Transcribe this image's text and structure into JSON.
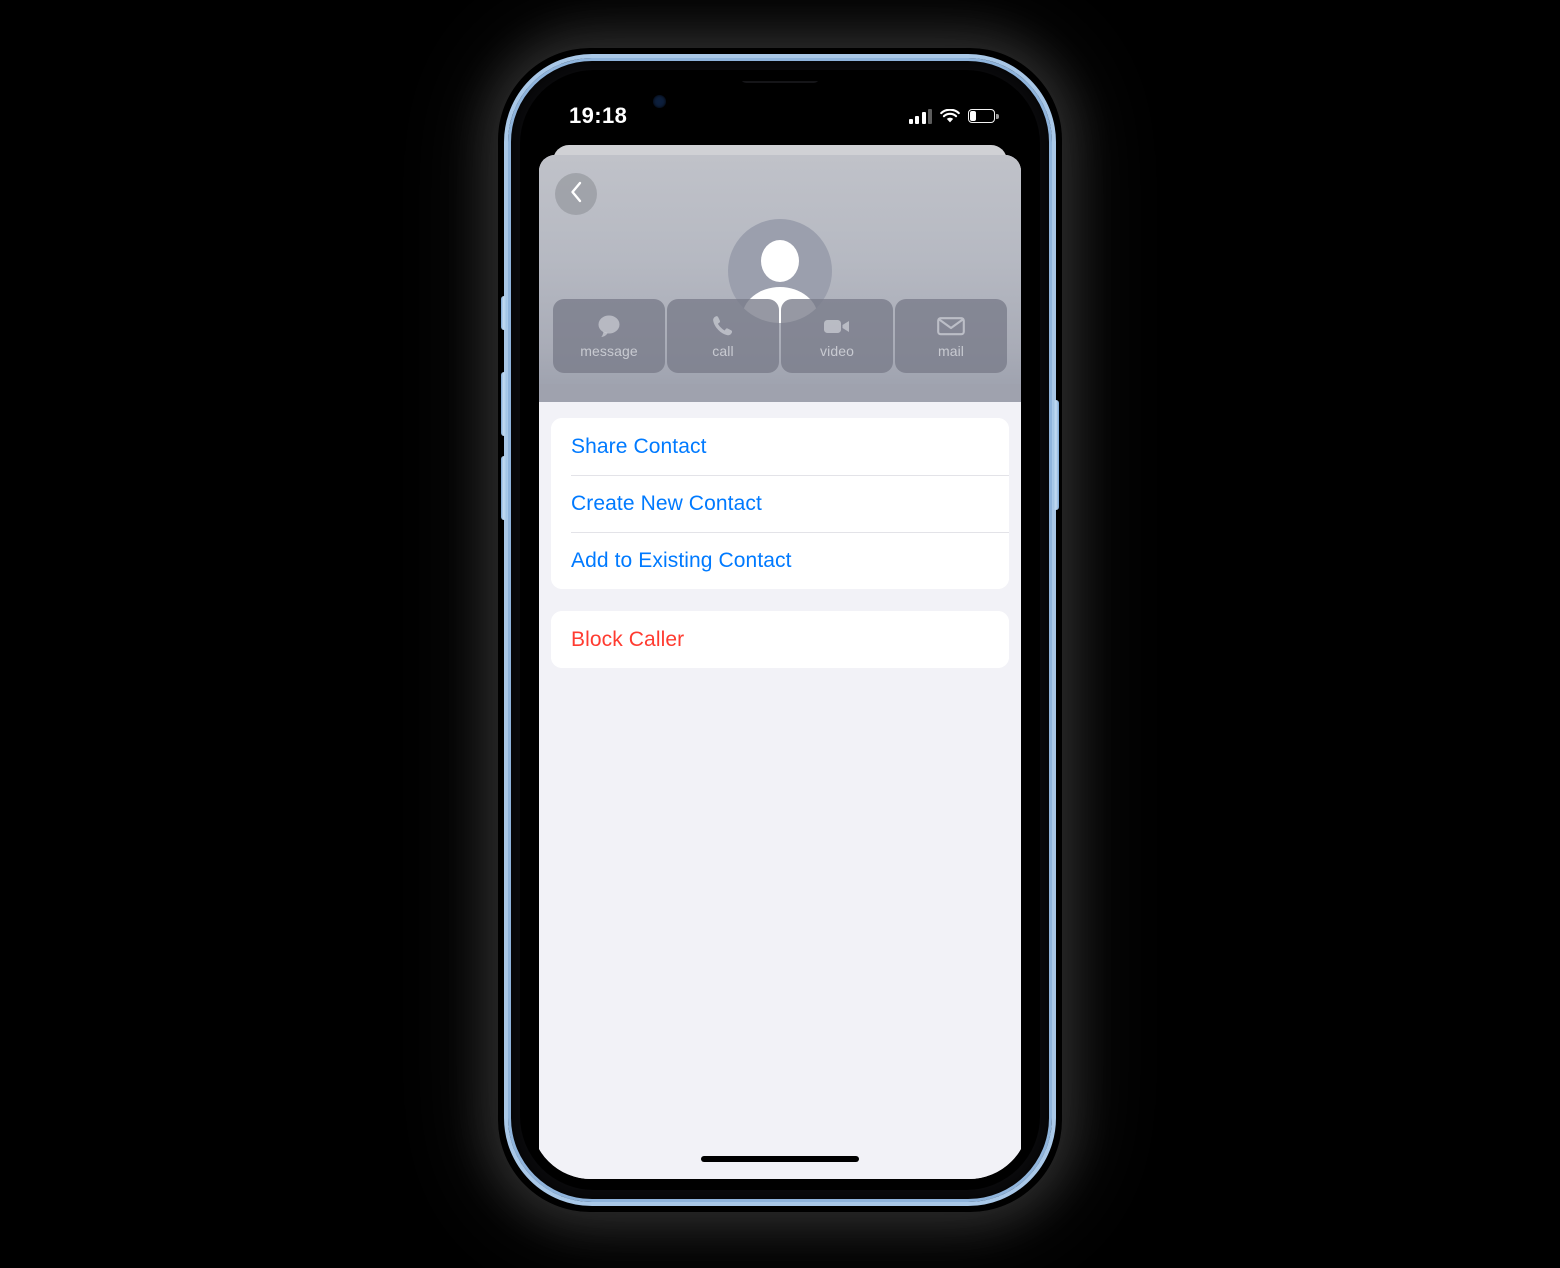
{
  "device": {
    "name": "iphone",
    "frame_color": "#a9c8e8",
    "buttons": [
      "mute-switch",
      "volume-up-button",
      "volume-down-button",
      "power-button"
    ]
  },
  "status_bar": {
    "time": "19:18",
    "cellular_icon": "signal-bars-icon",
    "cellular_bars_filled": 3,
    "cellular_bars_total": 4,
    "wifi_icon": "wifi-icon",
    "battery_icon": "battery-icon",
    "battery_level_percent": 22
  },
  "header": {
    "back_button_icon": "chevron-left-icon",
    "avatar_icon": "person-placeholder-icon",
    "contact_name": "",
    "dimmed": true,
    "actions": [
      {
        "id": "message",
        "label": "message",
        "icon": "message-bubble-icon"
      },
      {
        "id": "call",
        "label": "call",
        "icon": "phone-icon"
      },
      {
        "id": "video",
        "label": "video",
        "icon": "video-camera-icon"
      },
      {
        "id": "mail",
        "label": "mail",
        "icon": "envelope-icon"
      }
    ]
  },
  "menu": {
    "groups": [
      {
        "id": "contact-actions",
        "rows": [
          {
            "id": "share-contact",
            "label": "Share Contact",
            "style": "blue"
          },
          {
            "id": "create-new-contact",
            "label": "Create New Contact",
            "style": "blue"
          },
          {
            "id": "add-to-existing-contact",
            "label": "Add to Existing Contact",
            "style": "blue"
          }
        ]
      },
      {
        "id": "block-actions",
        "rows": [
          {
            "id": "block-caller",
            "label": "Block Caller",
            "style": "red"
          }
        ]
      }
    ]
  },
  "colors": {
    "system_blue": "#007AFF",
    "system_red": "#FF3B30",
    "list_background": "#F2F2F7",
    "row_background": "#FFFFFF",
    "header_grey": "#B6B9C2",
    "separator": "#E3E3E8"
  },
  "home_indicator": "home-indicator-bar"
}
